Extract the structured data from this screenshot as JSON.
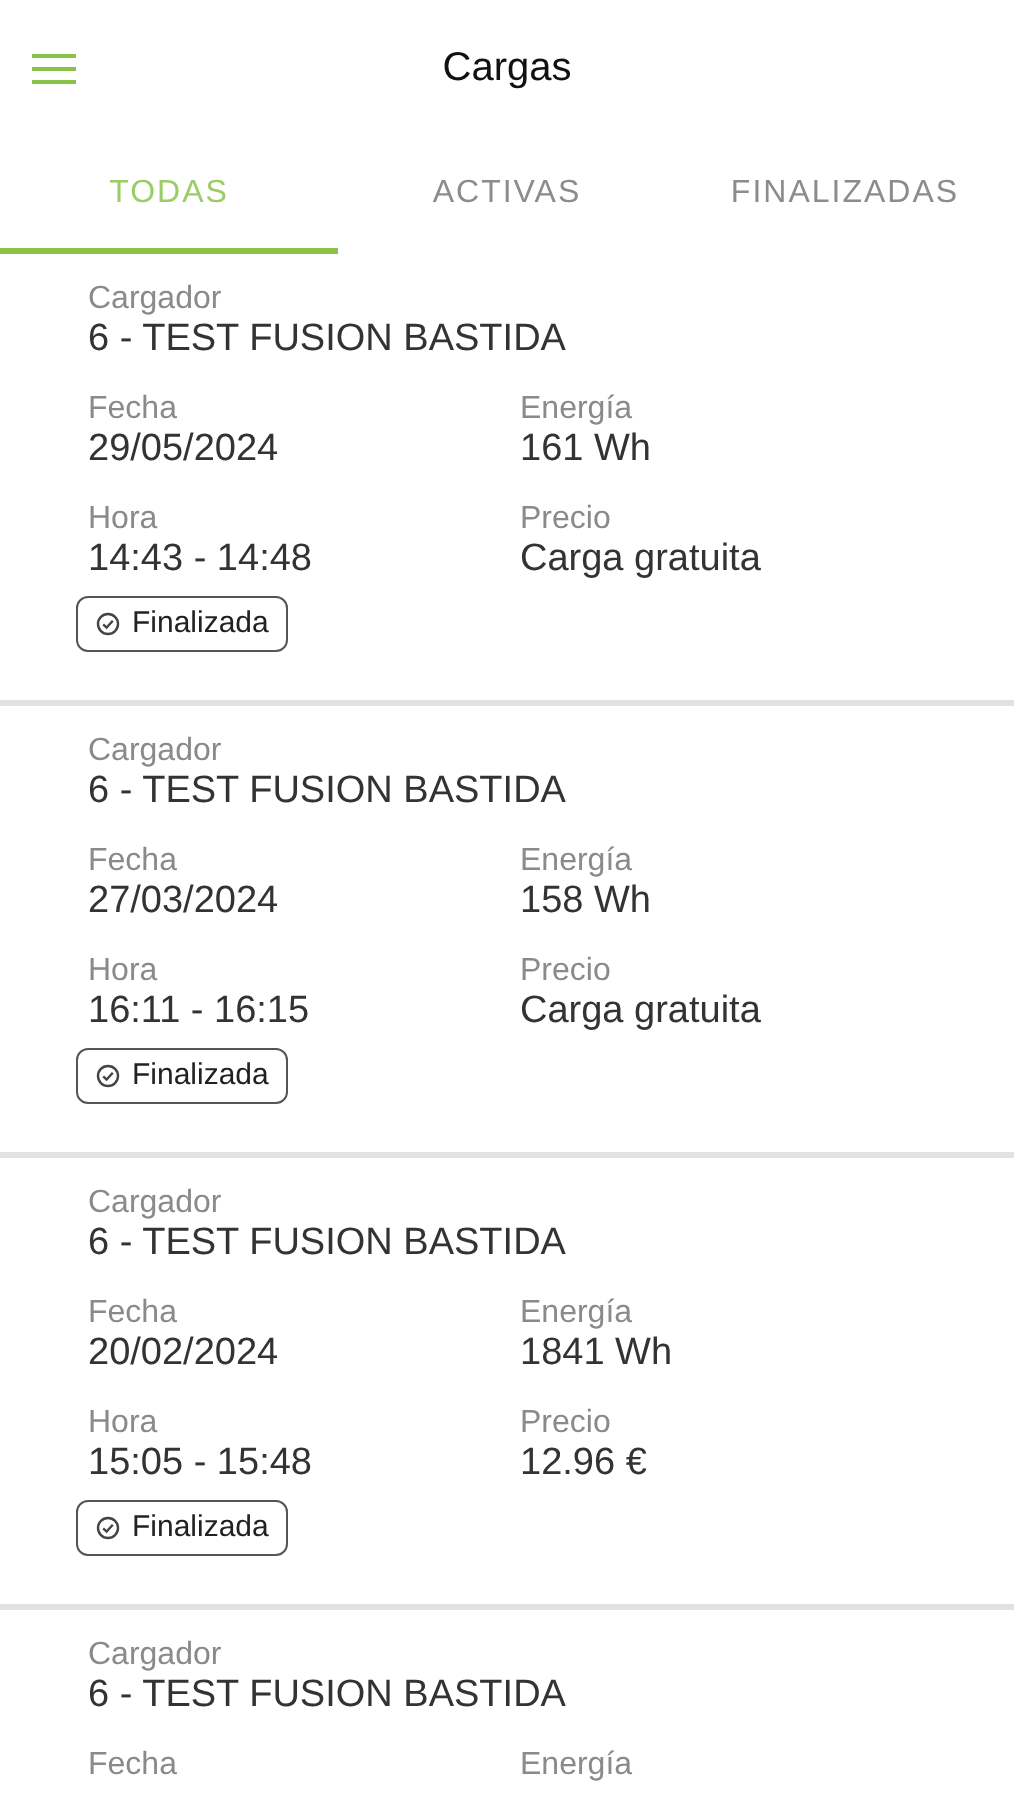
{
  "app_bar": {
    "title": "Cargas"
  },
  "tabs": [
    {
      "label": "TODAS",
      "selected": true
    },
    {
      "label": "ACTIVAS",
      "selected": false
    },
    {
      "label": "FINALIZADAS",
      "selected": false
    }
  ],
  "charges": [
    {
      "charger_label": "Cargador",
      "charger": "6 - TEST FUSION BASTIDA",
      "fields": [
        {
          "label": "Fecha",
          "value": "29/05/2024"
        },
        {
          "label": "Energía",
          "value": "161 Wh"
        },
        {
          "label": "Hora",
          "value": "14:43 - 14:48"
        },
        {
          "label": "Precio",
          "value": "Carga gratuita"
        }
      ],
      "status": "Finalizada"
    },
    {
      "charger_label": "Cargador",
      "charger": "6 - TEST FUSION BASTIDA",
      "fields": [
        {
          "label": "Fecha",
          "value": "27/03/2024"
        },
        {
          "label": "Energía",
          "value": "158 Wh"
        },
        {
          "label": "Hora",
          "value": "16:11 - 16:15"
        },
        {
          "label": "Precio",
          "value": "Carga gratuita"
        }
      ],
      "status": "Finalizada"
    },
    {
      "charger_label": "Cargador",
      "charger": "6 - TEST FUSION BASTIDA",
      "fields": [
        {
          "label": "Fecha",
          "value": "20/02/2024"
        },
        {
          "label": "Energía",
          "value": "1841 Wh"
        },
        {
          "label": "Hora",
          "value": "15:05 - 15:48"
        },
        {
          "label": "Precio",
          "value": "12.96 €"
        }
      ],
      "status": "Finalizada"
    },
    {
      "charger_label": "Cargador",
      "charger": "6 - TEST FUSION BASTIDA",
      "fields": [
        {
          "label": "Fecha"
        },
        {
          "label": "Energía"
        }
      ]
    }
  ]
}
